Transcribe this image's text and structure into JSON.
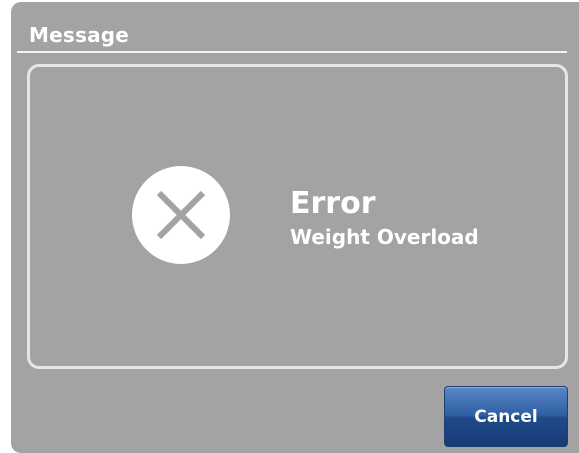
{
  "dialog": {
    "title": "Message",
    "icon": "error-x-icon",
    "message_title": "Error",
    "message_detail": "Weight Overload",
    "cancel_label": "Cancel"
  },
  "colors": {
    "dialog_background": "#a3a3a3",
    "text": "#ffffff",
    "cancel_button": "#2f5fa3"
  }
}
